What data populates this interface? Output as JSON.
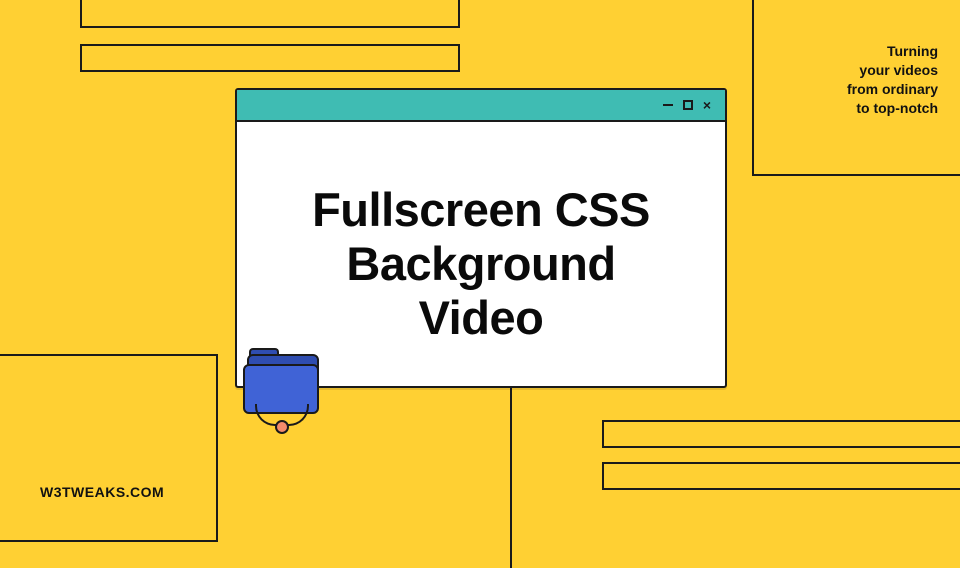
{
  "colors": {
    "background": "#ffd033",
    "ink": "#1a1a1a",
    "windowBar": "#3fbcb3",
    "folderFront": "#4063d6",
    "folderBack": "#2f4db0",
    "accentDot": "#f38b6b",
    "paper": "#ffffff"
  },
  "headline": {
    "line1": "Fullscreen CSS",
    "line2": "Background",
    "line3": "Video"
  },
  "tagline": {
    "line1": "Turning",
    "line2": "your videos",
    "line3": "from ordinary",
    "line4": "to top-notch"
  },
  "site_label": "W3TWEAKS.COM",
  "window_controls": {
    "close": "×"
  }
}
